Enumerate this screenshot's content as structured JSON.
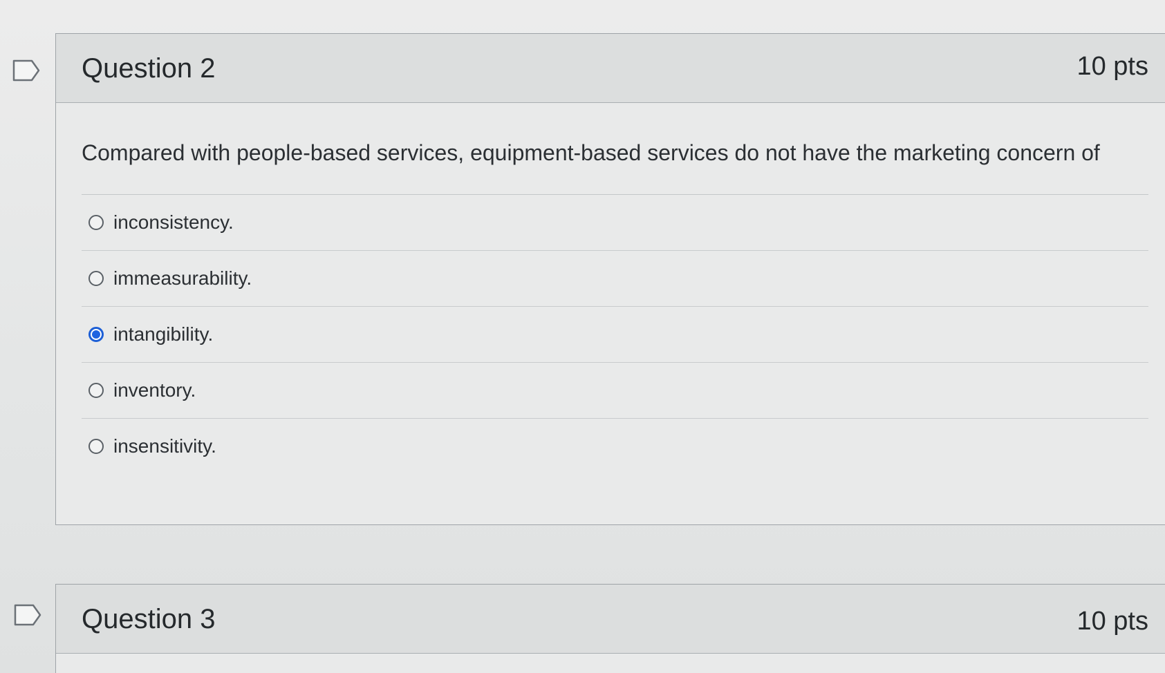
{
  "questions": [
    {
      "title": "Question 2",
      "points": "10 pts",
      "text": "Compared with people-based services, equipment-based services do not have the marketing concern of",
      "answers": [
        {
          "label": "inconsistency.",
          "selected": false
        },
        {
          "label": "immeasurability.",
          "selected": false
        },
        {
          "label": "intangibility.",
          "selected": true
        },
        {
          "label": "inventory.",
          "selected": false
        },
        {
          "label": "insensitivity.",
          "selected": false
        }
      ]
    },
    {
      "title": "Question 3",
      "points": "10 pts"
    }
  ],
  "colors": {
    "accent": "#1f63e0",
    "header_bg": "#dcdede",
    "body_bg": "#e9eaea",
    "border": "#9ea3a7"
  },
  "icons": {
    "flag": "bookmark-flag-icon",
    "radio": "radio-button-icon"
  }
}
